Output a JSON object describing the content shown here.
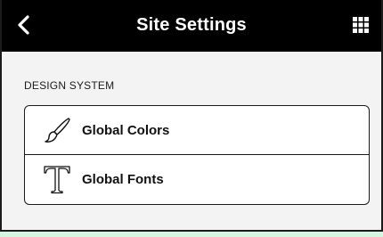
{
  "header": {
    "title": "Site Settings",
    "back_icon": "chevron-left-icon",
    "apps_icon": "grid-icon",
    "background": "#000000"
  },
  "section": {
    "heading": "DESIGN SYSTEM"
  },
  "items": [
    {
      "label": "Global Colors",
      "icon": "paintbrush-icon"
    },
    {
      "label": "Global Fonts",
      "icon": "typography-icon"
    }
  ],
  "colors": {
    "page_background": "#d8f5e2",
    "panel_background": "#f3f3f3",
    "card_background": "#ffffff"
  }
}
